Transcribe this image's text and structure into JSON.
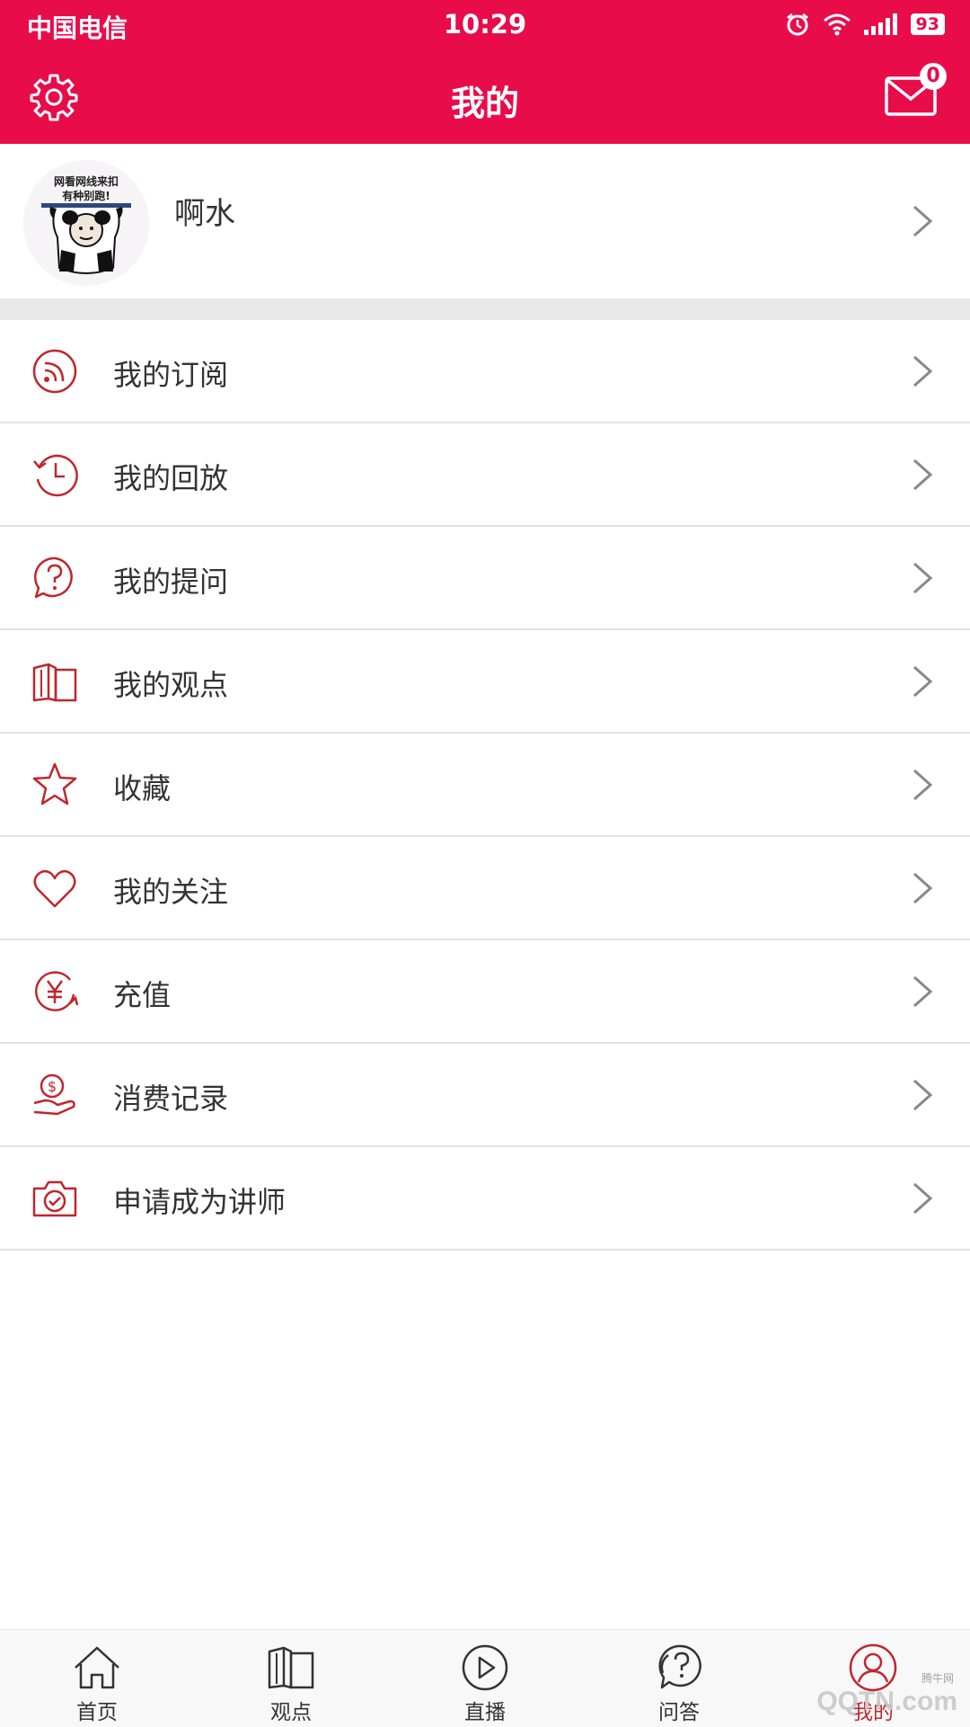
{
  "status_bar": {
    "carrier": "中国电信",
    "time": "10:29",
    "battery": "93",
    "icons": [
      "alarm-icon",
      "wifi-icon",
      "signal-icon",
      "battery-icon"
    ]
  },
  "header": {
    "title": "我的",
    "mail_count": "0",
    "left_icon": "gear-icon",
    "right_icon": "mail-icon"
  },
  "profile": {
    "name": "啊水",
    "avatar_caption_line1": "网看网线来扣",
    "avatar_caption_line2": "有种别跑!"
  },
  "menu": {
    "items": [
      {
        "label": "我的订阅",
        "icon": "rss-icon"
      },
      {
        "label": "我的回放",
        "icon": "history-icon"
      },
      {
        "label": "我的提问",
        "icon": "question-bubble-icon"
      },
      {
        "label": "我的观点",
        "icon": "open-book-icon"
      },
      {
        "label": "收藏",
        "icon": "star-icon"
      },
      {
        "label": "我的关注",
        "icon": "heart-icon"
      },
      {
        "label": "充值",
        "icon": "yuan-icon"
      },
      {
        "label": "消费记录",
        "icon": "coin-hand-icon"
      },
      {
        "label": "申请成为讲师",
        "icon": "camera-check-icon"
      }
    ]
  },
  "tabbar": {
    "tabs": [
      {
        "label": "首页",
        "icon": "home-icon"
      },
      {
        "label": "观点",
        "icon": "open-book-icon"
      },
      {
        "label": "直播",
        "icon": "play-icon"
      },
      {
        "label": "问答",
        "icon": "question-bubble-icon"
      },
      {
        "label": "我的",
        "icon": "user-icon",
        "active": true
      }
    ]
  },
  "watermark": {
    "text": "QQTN.com",
    "small": "腾牛网"
  },
  "colors": {
    "brand": "#e80c4a",
    "icon_red": "#c0262d",
    "divider": "#e2e2e2",
    "band": "#e8e8e8"
  }
}
